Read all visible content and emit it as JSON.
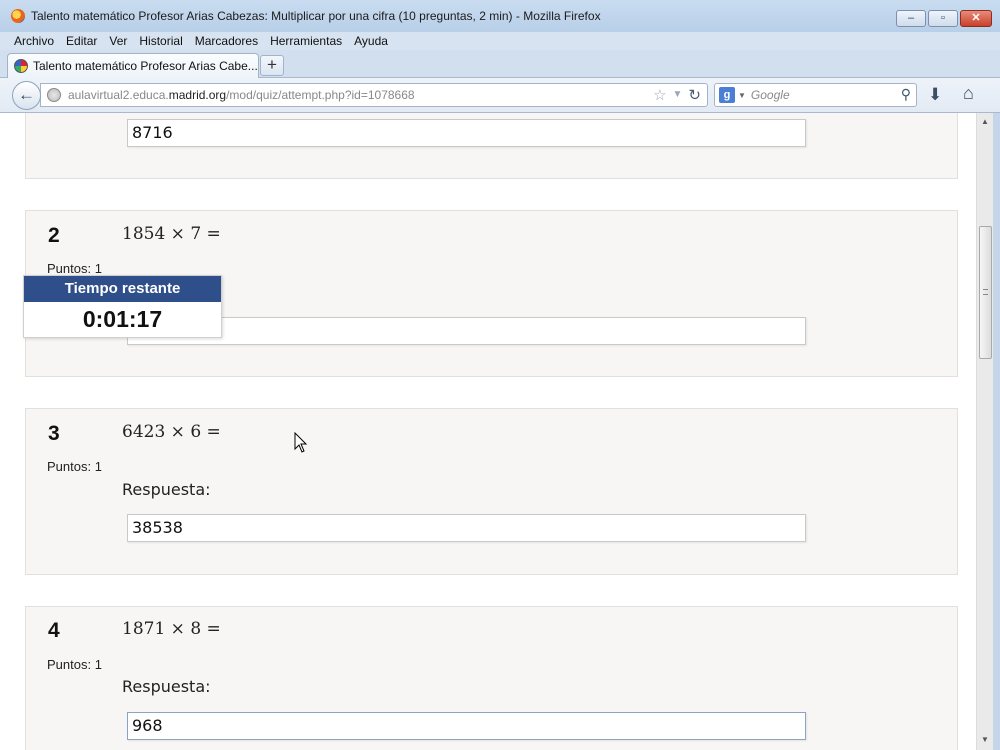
{
  "window": {
    "title": "Talento matemático Profesor Arias Cabezas: Multiplicar por una cifra (10 preguntas, 2 min) - Mozilla Firefox",
    "minimize": "▭",
    "maximize": "❐",
    "close": "✕"
  },
  "menu": [
    "Archivo",
    "Editar",
    "Ver",
    "Historial",
    "Marcadores",
    "Herramientas",
    "Ayuda"
  ],
  "tab": {
    "label": "Talento matemático Profesor Arias Cabe...",
    "new_tab": "+"
  },
  "nav": {
    "url_prefix": "aulavirtual2.educa.",
    "url_domain": "madrid.org",
    "url_path": "/mod/quiz/attempt.php?id=1078668",
    "search_engine": "g",
    "search_placeholder": "Google"
  },
  "questions": [
    {
      "answer": "8716"
    },
    {
      "number": "2",
      "text": "1854 × 7 =",
      "points": "Puntos: 1",
      "answer": ""
    },
    {
      "number": "3",
      "text": "6423 × 6 =",
      "points": "Puntos: 1",
      "response_label": "Respuesta:",
      "answer": "38538"
    },
    {
      "number": "4",
      "text": "1871 × 8 =",
      "points": "Puntos: 1",
      "response_label": "Respuesta:",
      "answer": "968"
    }
  ],
  "timer": {
    "label": "Tiempo restante",
    "value": "0:01:17"
  }
}
